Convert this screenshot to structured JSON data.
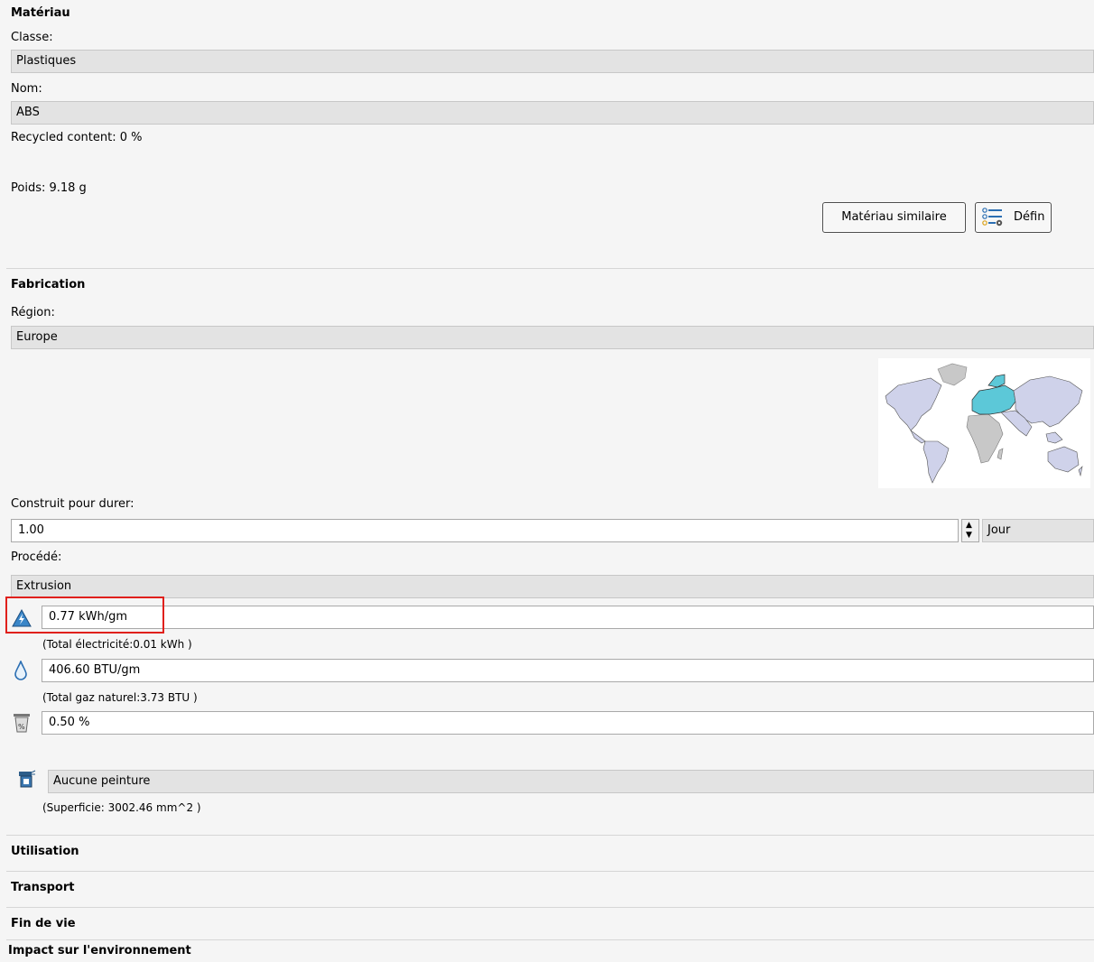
{
  "material": {
    "title": "Matériau",
    "class_label": "Classe:",
    "class_value": "Plastiques",
    "name_label": "Nom:",
    "name_value": "ABS",
    "recycled": "Recycled content: 0 %",
    "weight": "Poids:  9.18 g",
    "similar_button": "Matériau similaire",
    "define_button": "Défin"
  },
  "fabrication": {
    "title": "Fabrication",
    "region_label": "Région:",
    "region_value": "Europe",
    "duration_label": "Construit pour durer:",
    "duration_value": "1.00",
    "duration_unit": "Jour",
    "process_label": "Procédé:",
    "process_value": "Extrusion",
    "electricity_value": "0.77 kWh/gm",
    "electricity_total": "(Total électricité:0.01 kWh )",
    "gas_value": "406.60 BTU/gm",
    "gas_total": "(Total gaz naturel:3.73 BTU )",
    "scrap_value": "0.50 %",
    "paint_value": "Aucune peinture",
    "surface": "(Superficie: 3002.46 mm^2 )"
  },
  "sections": {
    "use": "Utilisation",
    "transport": "Transport",
    "end_of_life": "Fin de vie",
    "impact": "Impact sur l'environnement"
  },
  "colors": {
    "highlight": "#e0201c",
    "europe": "#5cc8d8",
    "continents": "#cfd2ea",
    "inactive_region": "#c8c8c8"
  },
  "icons": {
    "electricity": "electricity-warning-icon",
    "gas": "gas-drop-icon",
    "scrap": "recycle-bin-percent-icon",
    "paint": "spray-paint-icon",
    "define": "settings-list-icon"
  }
}
